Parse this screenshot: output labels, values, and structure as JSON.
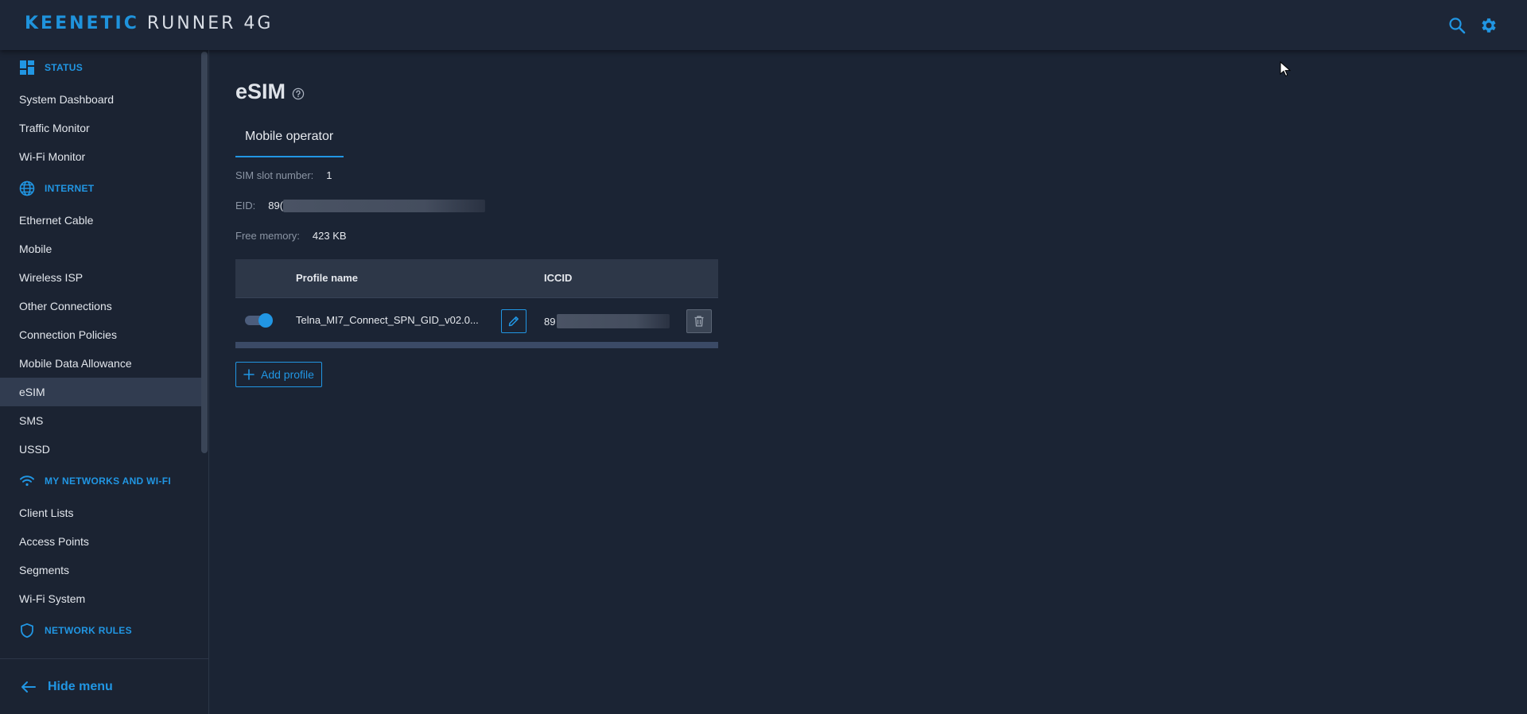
{
  "header": {
    "brand": "KEENETIC",
    "model": "RUNNER 4G",
    "icons": [
      "search-icon",
      "gear-icon"
    ],
    "accent_color": "#2196e3"
  },
  "sidebar": {
    "sections": [
      {
        "title": "STATUS",
        "icon": "dashboard-icon",
        "items": [
          {
            "label": "System Dashboard"
          },
          {
            "label": "Traffic Monitor"
          },
          {
            "label": "Wi-Fi Monitor"
          }
        ]
      },
      {
        "title": "INTERNET",
        "icon": "globe-icon",
        "items": [
          {
            "label": "Ethernet Cable"
          },
          {
            "label": "Mobile"
          },
          {
            "label": "Wireless ISP"
          },
          {
            "label": "Other Connections"
          },
          {
            "label": "Connection Policies"
          },
          {
            "label": "Mobile Data Allowance"
          },
          {
            "label": "eSIM",
            "active": true
          },
          {
            "label": "SMS"
          },
          {
            "label": "USSD"
          }
        ]
      },
      {
        "title": "MY NETWORKS AND WI-FI",
        "icon": "wifi-icon",
        "items": [
          {
            "label": "Client Lists"
          },
          {
            "label": "Access Points"
          },
          {
            "label": "Segments"
          },
          {
            "label": "Wi-Fi System"
          }
        ]
      },
      {
        "title": "NETWORK RULES",
        "icon": "shield-icon",
        "items": []
      }
    ],
    "hide_menu_label": "Hide menu"
  },
  "main": {
    "title": "eSIM",
    "tab_label": "Mobile operator",
    "sim_slot": {
      "label": "SIM slot number:",
      "value": "1"
    },
    "eid": {
      "label": "EID:",
      "value": "89("
    },
    "free_memory": {
      "label": "Free memory:",
      "value": "423 KB"
    },
    "table": {
      "headers": {
        "profile_name": "Profile name",
        "iccid": "ICCID"
      },
      "rows": [
        {
          "enabled": true,
          "profile_name": "Telna_MI7_Connect_SPN_GID_v02.0...",
          "iccid": "89"
        }
      ]
    },
    "add_profile_label": "Add profile"
  }
}
